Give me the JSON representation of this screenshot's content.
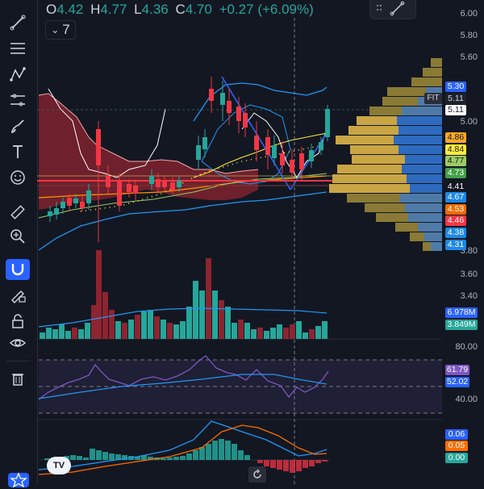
{
  "ohlc": {
    "open_key": "O",
    "open": "4.42",
    "high_key": "H",
    "high": "4.77",
    "low_key": "L",
    "low": "4.36",
    "close_key": "C",
    "close": "4.70",
    "change": "+0.27 (+6.09%)"
  },
  "indicator_count": "7",
  "fit_label": "FIT",
  "price_axis": [
    "6.00",
    "5.80",
    "5.60",
    "5.00",
    "3.80",
    "3.60",
    "3.40"
  ],
  "price_tags": [
    {
      "value": "5.30",
      "bg": "#2962ff",
      "fg": "#ffffff"
    },
    {
      "value": "5.11",
      "bg": "#1e222d",
      "fg": "#d1d4dc"
    },
    {
      "value": "5.11",
      "bg": "#ffffff",
      "fg": "#131722"
    },
    {
      "value": "4.86",
      "bg": "#f9a825",
      "fg": "#131722"
    },
    {
      "value": "4.84",
      "bg": "#ffeb3b",
      "fg": "#131722"
    },
    {
      "value": "4.77",
      "bg": "#9ccc65",
      "fg": "#131722"
    },
    {
      "value": "4.73",
      "bg": "#43a047",
      "fg": "#ffffff"
    },
    {
      "value": "4.41",
      "bg": "#131722",
      "fg": "#ffffff"
    },
    {
      "value": "4.67",
      "bg": "#1e88e5",
      "fg": "#ffffff"
    },
    {
      "value": "4.53",
      "bg": "#ef6c00",
      "fg": "#ffffff"
    },
    {
      "value": "4.46",
      "bg": "#f23645",
      "fg": "#ffffff"
    },
    {
      "value": "4.38",
      "bg": "#1e88e5",
      "fg": "#ffffff"
    },
    {
      "value": "4.31",
      "bg": "#1e88e5",
      "fg": "#ffffff"
    }
  ],
  "volume_tags": [
    {
      "value": "6.978M",
      "bg": "#2962ff",
      "fg": "#ffffff"
    },
    {
      "value": "3.849M",
      "bg": "#26a69a",
      "fg": "#ffffff"
    }
  ],
  "rsi_axis": [
    "80.00",
    "40.00"
  ],
  "rsi_tags": [
    {
      "value": "61.79",
      "bg": "#7e57c2",
      "fg": "#ffffff"
    },
    {
      "value": "52.02",
      "bg": "#2962ff",
      "fg": "#ffffff"
    }
  ],
  "macd_tags": [
    {
      "value": "0.06",
      "bg": "#2962ff",
      "fg": "#ffffff"
    },
    {
      "value": "0.05",
      "bg": "#ff6d00",
      "fg": "#ffffff"
    },
    {
      "value": "0.00",
      "bg": "#26a69a",
      "fg": "#ffffff"
    }
  ],
  "tools": [
    "trend-line",
    "horizontal-lines",
    "pattern",
    "forecast",
    "brush",
    "text",
    "emoji",
    "ruler",
    "zoom",
    "magnet",
    "lock-pencil",
    "lock",
    "eye",
    "trash"
  ],
  "colors": {
    "up": "#26a69a",
    "down": "#f23645",
    "bg": "#131722",
    "grid": "#2a2e39"
  }
}
